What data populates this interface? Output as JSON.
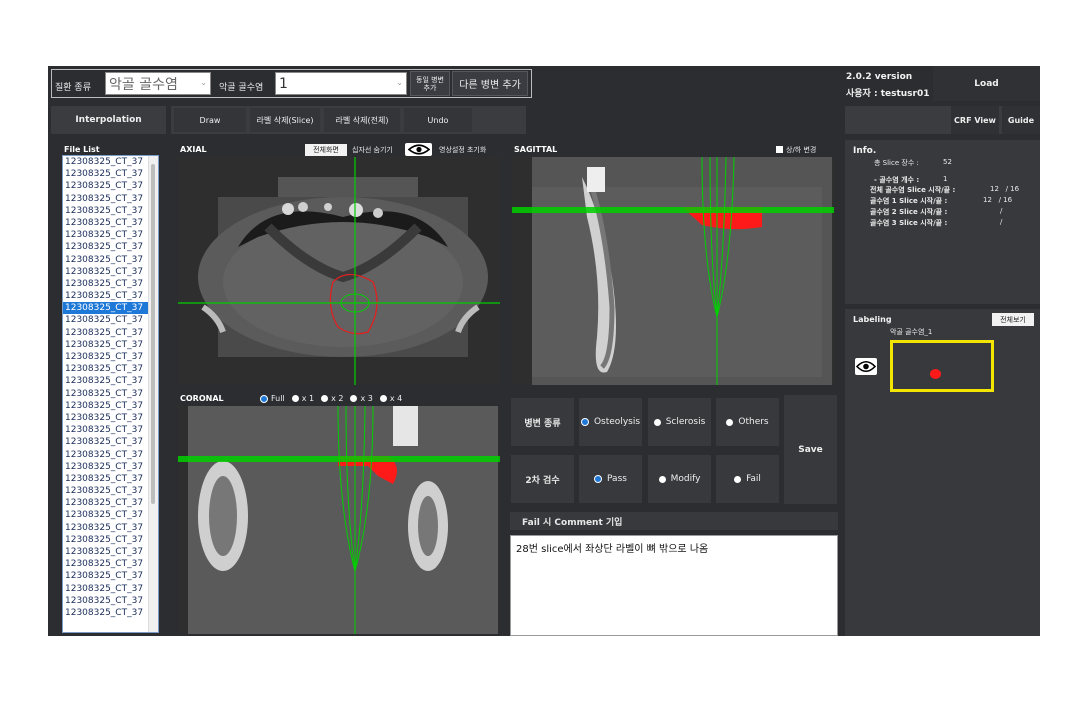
{
  "toolbar": {
    "disease_type_label": "질환 종류",
    "disease_type_value": "악골 골수염",
    "disease_label": "악골 골수염",
    "disease_value": "1",
    "same_lesion_button": "동일 병변 추가",
    "other_lesion_button": "다른 병변 추가",
    "version": "2.0.2 version",
    "user": "사용자 : testusr01",
    "load_button": "Load"
  },
  "actions": {
    "interpolation": "Interpolation",
    "draw": "Draw",
    "delete_slice": "라벨 삭제(Slice)",
    "delete_all": "라벨 삭제(전체)",
    "undo": "Undo",
    "crf_view": "CRF View",
    "guide": "Guide"
  },
  "file_list": {
    "title": "File List",
    "selected_index": 12,
    "items": [
      "12308325_CT_37",
      "12308325_CT_37",
      "12308325_CT_37",
      "12308325_CT_37",
      "12308325_CT_37",
      "12308325_CT_37",
      "12308325_CT_37",
      "12308325_CT_37",
      "12308325_CT_37",
      "12308325_CT_37",
      "12308325_CT_37",
      "12308325_CT_37",
      "12308325_CT_37",
      "12308325_CT_37",
      "12308325_CT_37",
      "12308325_CT_37",
      "12308325_CT_37",
      "12308325_CT_37",
      "12308325_CT_37",
      "12308325_CT_37",
      "12308325_CT_37",
      "12308325_CT_37",
      "12308325_CT_37",
      "12308325_CT_37",
      "12308325_CT_37",
      "12308325_CT_37",
      "12308325_CT_37",
      "12308325_CT_37",
      "12308325_CT_37",
      "12308325_CT_37",
      "12308325_CT_37",
      "12308325_CT_37",
      "12308325_CT_37",
      "12308325_CT_37",
      "12308325_CT_37",
      "12308325_CT_37",
      "12308325_CT_37",
      "12308325_CT_37"
    ]
  },
  "axial": {
    "title": "AXIAL",
    "fullscreen": "전체화면",
    "hide_cross": "십자선 숨기기",
    "reset_view": "영상설정 초기화"
  },
  "sagittal": {
    "title": "SAGITTAL",
    "flip": "상/하 변경"
  },
  "coronal": {
    "title": "CORONAL",
    "zoom_options": [
      "Full",
      "x 1",
      "x 2",
      "x 3",
      "x 4"
    ],
    "zoom_selected": 0
  },
  "info": {
    "title": "Info.",
    "total_slices_label": "총 Slice 장수 :",
    "total_slices_value": "52",
    "count_label": "- 골수염 개수 :",
    "count_value": "1",
    "all_range_label": "전체 골수염 Slice 시작/끝 :",
    "all_range_value": "12   / 16",
    "r1_label": "골수염 1 Slice 시작/끝 :",
    "r1_value": "12   / 16",
    "r2_label": "골수염 2 Slice 시작/끝 :",
    "r2_value": "/",
    "r3_label": "골수염 3 Slice 시작/끝 :",
    "r3_value": "/"
  },
  "labeling": {
    "title": "Labeling",
    "view_all": "전체보기",
    "item_label": "악골 골수염_1"
  },
  "review": {
    "lesion_type_label": "병변 종류",
    "lesion_options": [
      "Osteolysis",
      "Sclerosis",
      "Others"
    ],
    "lesion_selected": 0,
    "second_review_label": "2차 검수",
    "review_options": [
      "Pass",
      "Modify",
      "Fail"
    ],
    "review_selected": 0,
    "save_button": "Save",
    "comment_header": "Fail 시 Comment 기입",
    "comment_text": "28번 slice에서 좌상단 라벨이 뼈 밖으로 나옴"
  },
  "colors": {
    "background": "#2b2d31",
    "panel": "#38393d",
    "accent": "#1e78d7",
    "crosshair": "#00d000",
    "label_red": "#ff1a1a",
    "thumb_border": "#f2e600"
  }
}
